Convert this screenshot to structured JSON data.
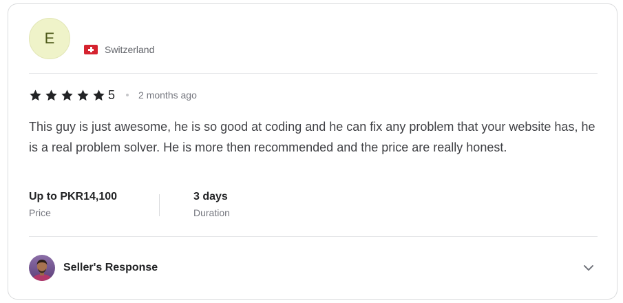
{
  "reviewer": {
    "initial": "E",
    "country": "Switzerland",
    "flag_icon": "switzerland-flag-icon"
  },
  "rating": {
    "stars": 5,
    "value": "5",
    "time_ago": "2 months ago",
    "star_color": "#222325"
  },
  "review": {
    "text": "This guy is just awesome, he is so good at coding and he can fix any problem that your website has, he is a real problem solver. He is more then recommended and the price are really honest."
  },
  "stats": {
    "price_value": "Up to PKR14,100",
    "price_label": "Price",
    "duration_value": "3 days",
    "duration_label": "Duration"
  },
  "seller_response": {
    "title": "Seller's Response",
    "toggle_icon": "chevron-down-icon"
  }
}
